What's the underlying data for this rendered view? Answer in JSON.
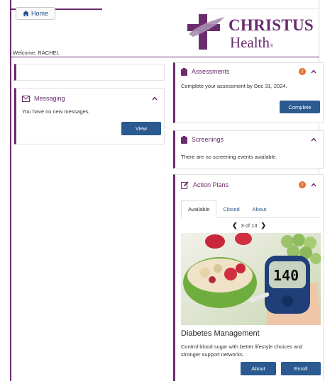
{
  "header": {
    "home_label": "Home",
    "welcome_text": "Welcome, RACHEL",
    "logo": {
      "line1": "CHRISTUS",
      "line2": "Health",
      "reg": "®"
    }
  },
  "colors": {
    "brand": "#6b2c6e",
    "button": "#2a5a8f",
    "alert": "#e8712a"
  },
  "messaging": {
    "title": "Messaging",
    "icon": "envelope-icon",
    "text": "You have no new messages.",
    "button": "View"
  },
  "assessments": {
    "title": "Assessments",
    "icon": "clipboard-icon",
    "alert": "!",
    "text": "Complete your assessment by Dec 31, 2024.",
    "button": "Complete"
  },
  "screenings": {
    "title": "Screenings",
    "icon": "clipboard-icon",
    "text": "There are no screening events available."
  },
  "action_plans": {
    "title": "Action Plans",
    "icon": "edit-icon",
    "alert": "!",
    "tabs": [
      "Available",
      "Closed",
      "About"
    ],
    "active_tab": "Available",
    "pager": "3 of 13",
    "meter_reading": "140",
    "plan_title": "Diabetes Management",
    "plan_desc": "Control blood sugar with better lifestyle choices and stronger support networks.",
    "about_button": "About",
    "enroll_button": "Enroll"
  }
}
